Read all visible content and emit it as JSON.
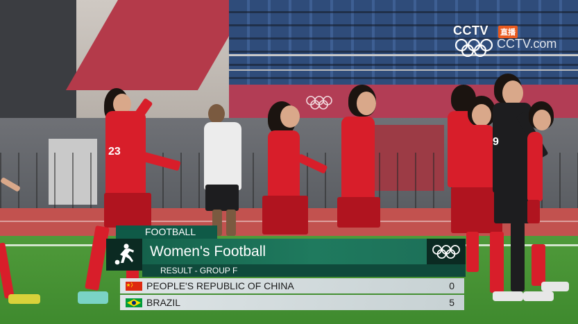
{
  "broadcaster": {
    "logo_text": "CCTV",
    "live_badge": "直播",
    "site": "CCTV.com",
    "rings_icon": "olympic-rings-icon"
  },
  "graphic": {
    "sport_label": "FOOTBALL",
    "event_title": "Women's Football",
    "subtitle": "RESULT - GROUP F",
    "pictogram_icon": "football-pictogram-icon",
    "rings_icon": "olympic-rings-icon",
    "teams": [
      {
        "name": "PEOPLE'S REPUBLIC OF CHINA",
        "score": "0",
        "flag": "china-flag"
      },
      {
        "name": "BRAZIL",
        "score": "5",
        "flag": "brazil-flag"
      }
    ]
  },
  "jersey_numbers": [
    "23",
    "9"
  ],
  "colors": {
    "graphic_green": "#1f7a5e",
    "graphic_dark": "#0b2a22",
    "china_kit_red": "#d81e2a",
    "goalkeeper_black": "#1d1d1f",
    "live_badge": "#e85a1f"
  }
}
